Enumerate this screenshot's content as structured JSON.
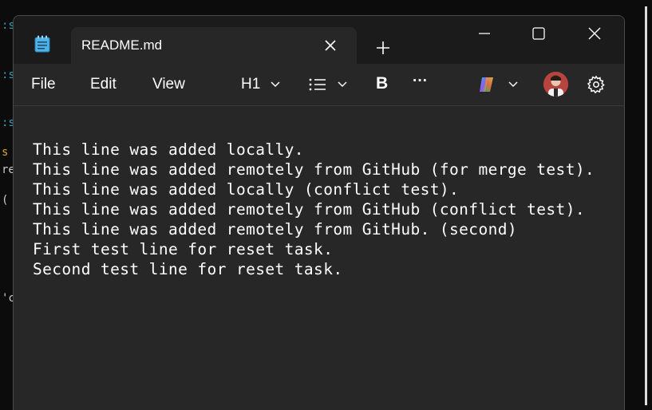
{
  "tab": {
    "title": "README.md"
  },
  "menu": {
    "file": "File",
    "edit": "Edit",
    "view": "View"
  },
  "toolbar": {
    "heading": "H1",
    "list_icon": "bulleted-list-icon",
    "bold_label": "B",
    "more_label": "···",
    "copilot_icon": "copilot-icon",
    "settings_icon": "gear-icon"
  },
  "editor": {
    "lines": [
      "This line was added locally.",
      "This line was added remotely from GitHub (for merge test).",
      "This line was added locally (conflict test).",
      "This line was added remotely from GitHub (conflict test).",
      "This line was added remotely from GitHub. (second)",
      "First test line for reset task.",
      "Second test line for reset task."
    ]
  },
  "background": {
    "fragments": [
      ":s",
      ":s",
      ":s",
      "s",
      "re",
      "(",
      "'c"
    ]
  },
  "colors": {
    "window_bg": "#272727",
    "titlebar_bg": "#1b1b1b",
    "text": "#ffffff",
    "terminal_accent": "#3aa0b8"
  }
}
